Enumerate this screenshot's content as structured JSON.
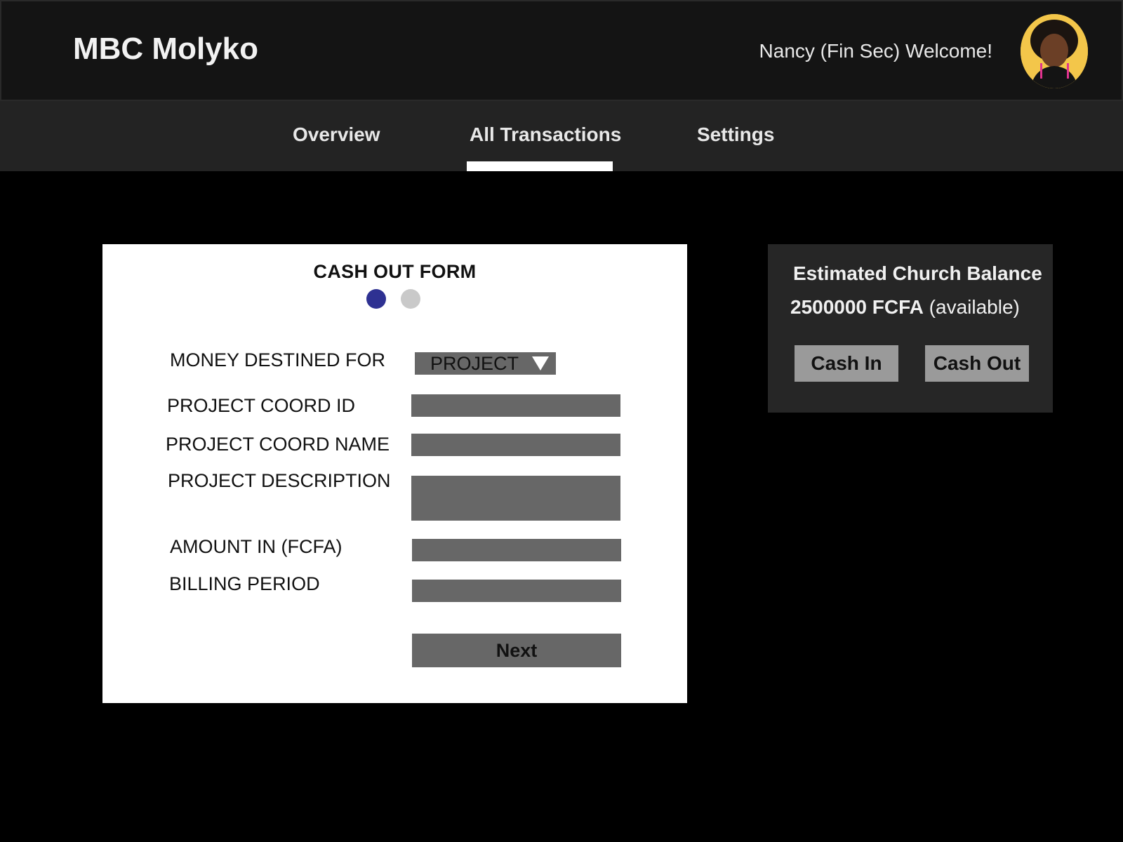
{
  "header": {
    "brand": "MBC Molyko",
    "welcome_text": "Nancy (Fin Sec) Welcome!",
    "avatar_icon": "user-avatar-icon"
  },
  "nav": {
    "tabs": [
      {
        "label": "Overview",
        "active": false
      },
      {
        "label": "All Transactions",
        "active": true
      },
      {
        "label": "Settings",
        "active": false
      }
    ]
  },
  "form": {
    "title": "CASH OUT FORM",
    "steps": {
      "current": 1,
      "total": 2
    },
    "step_colors": {
      "active": "#2e3192",
      "inactive": "#c9c9c9"
    },
    "fields": {
      "money_destined_for": {
        "label": "MONEY DESTINED FOR",
        "value": "PROJECT"
      },
      "project_coord_id": {
        "label": "PROJECT COORD ID",
        "value": ""
      },
      "project_coord_name": {
        "label": "PROJECT COORD NAME",
        "value": ""
      },
      "project_description": {
        "label": "PROJECT DESCRIPTION",
        "value": ""
      },
      "amount": {
        "label": "AMOUNT IN (FCFA)",
        "value": ""
      },
      "billing_period": {
        "label": "BILLING PERIOD",
        "value": ""
      }
    },
    "next_label": "Next"
  },
  "balance": {
    "title": "Estimated Church Balance",
    "amount": "2500000 FCFA",
    "note": "(available)",
    "cash_in_label": "Cash In",
    "cash_out_label": "Cash Out"
  }
}
